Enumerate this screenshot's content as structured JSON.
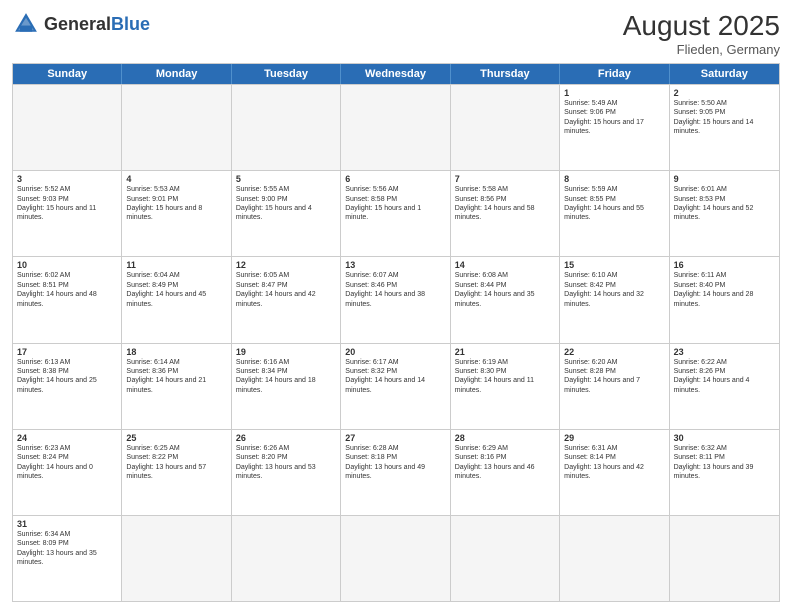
{
  "header": {
    "logo_general": "General",
    "logo_blue": "Blue",
    "month_year": "August 2025",
    "location": "Flieden, Germany"
  },
  "days_of_week": [
    "Sunday",
    "Monday",
    "Tuesday",
    "Wednesday",
    "Thursday",
    "Friday",
    "Saturday"
  ],
  "rows": [
    [
      {
        "day": "",
        "info": ""
      },
      {
        "day": "",
        "info": ""
      },
      {
        "day": "",
        "info": ""
      },
      {
        "day": "",
        "info": ""
      },
      {
        "day": "",
        "info": ""
      },
      {
        "day": "1",
        "info": "Sunrise: 5:49 AM\nSunset: 9:06 PM\nDaylight: 15 hours and 17 minutes."
      },
      {
        "day": "2",
        "info": "Sunrise: 5:50 AM\nSunset: 9:05 PM\nDaylight: 15 hours and 14 minutes."
      }
    ],
    [
      {
        "day": "3",
        "info": "Sunrise: 5:52 AM\nSunset: 9:03 PM\nDaylight: 15 hours and 11 minutes."
      },
      {
        "day": "4",
        "info": "Sunrise: 5:53 AM\nSunset: 9:01 PM\nDaylight: 15 hours and 8 minutes."
      },
      {
        "day": "5",
        "info": "Sunrise: 5:55 AM\nSunset: 9:00 PM\nDaylight: 15 hours and 4 minutes."
      },
      {
        "day": "6",
        "info": "Sunrise: 5:56 AM\nSunset: 8:58 PM\nDaylight: 15 hours and 1 minute."
      },
      {
        "day": "7",
        "info": "Sunrise: 5:58 AM\nSunset: 8:56 PM\nDaylight: 14 hours and 58 minutes."
      },
      {
        "day": "8",
        "info": "Sunrise: 5:59 AM\nSunset: 8:55 PM\nDaylight: 14 hours and 55 minutes."
      },
      {
        "day": "9",
        "info": "Sunrise: 6:01 AM\nSunset: 8:53 PM\nDaylight: 14 hours and 52 minutes."
      }
    ],
    [
      {
        "day": "10",
        "info": "Sunrise: 6:02 AM\nSunset: 8:51 PM\nDaylight: 14 hours and 48 minutes."
      },
      {
        "day": "11",
        "info": "Sunrise: 6:04 AM\nSunset: 8:49 PM\nDaylight: 14 hours and 45 minutes."
      },
      {
        "day": "12",
        "info": "Sunrise: 6:05 AM\nSunset: 8:47 PM\nDaylight: 14 hours and 42 minutes."
      },
      {
        "day": "13",
        "info": "Sunrise: 6:07 AM\nSunset: 8:46 PM\nDaylight: 14 hours and 38 minutes."
      },
      {
        "day": "14",
        "info": "Sunrise: 6:08 AM\nSunset: 8:44 PM\nDaylight: 14 hours and 35 minutes."
      },
      {
        "day": "15",
        "info": "Sunrise: 6:10 AM\nSunset: 8:42 PM\nDaylight: 14 hours and 32 minutes."
      },
      {
        "day": "16",
        "info": "Sunrise: 6:11 AM\nSunset: 8:40 PM\nDaylight: 14 hours and 28 minutes."
      }
    ],
    [
      {
        "day": "17",
        "info": "Sunrise: 6:13 AM\nSunset: 8:38 PM\nDaylight: 14 hours and 25 minutes."
      },
      {
        "day": "18",
        "info": "Sunrise: 6:14 AM\nSunset: 8:36 PM\nDaylight: 14 hours and 21 minutes."
      },
      {
        "day": "19",
        "info": "Sunrise: 6:16 AM\nSunset: 8:34 PM\nDaylight: 14 hours and 18 minutes."
      },
      {
        "day": "20",
        "info": "Sunrise: 6:17 AM\nSunset: 8:32 PM\nDaylight: 14 hours and 14 minutes."
      },
      {
        "day": "21",
        "info": "Sunrise: 6:19 AM\nSunset: 8:30 PM\nDaylight: 14 hours and 11 minutes."
      },
      {
        "day": "22",
        "info": "Sunrise: 6:20 AM\nSunset: 8:28 PM\nDaylight: 14 hours and 7 minutes."
      },
      {
        "day": "23",
        "info": "Sunrise: 6:22 AM\nSunset: 8:26 PM\nDaylight: 14 hours and 4 minutes."
      }
    ],
    [
      {
        "day": "24",
        "info": "Sunrise: 6:23 AM\nSunset: 8:24 PM\nDaylight: 14 hours and 0 minutes."
      },
      {
        "day": "25",
        "info": "Sunrise: 6:25 AM\nSunset: 8:22 PM\nDaylight: 13 hours and 57 minutes."
      },
      {
        "day": "26",
        "info": "Sunrise: 6:26 AM\nSunset: 8:20 PM\nDaylight: 13 hours and 53 minutes."
      },
      {
        "day": "27",
        "info": "Sunrise: 6:28 AM\nSunset: 8:18 PM\nDaylight: 13 hours and 49 minutes."
      },
      {
        "day": "28",
        "info": "Sunrise: 6:29 AM\nSunset: 8:16 PM\nDaylight: 13 hours and 46 minutes."
      },
      {
        "day": "29",
        "info": "Sunrise: 6:31 AM\nSunset: 8:14 PM\nDaylight: 13 hours and 42 minutes."
      },
      {
        "day": "30",
        "info": "Sunrise: 6:32 AM\nSunset: 8:11 PM\nDaylight: 13 hours and 39 minutes."
      }
    ],
    [
      {
        "day": "31",
        "info": "Sunrise: 6:34 AM\nSunset: 8:09 PM\nDaylight: 13 hours and 35 minutes."
      },
      {
        "day": "",
        "info": ""
      },
      {
        "day": "",
        "info": ""
      },
      {
        "day": "",
        "info": ""
      },
      {
        "day": "",
        "info": ""
      },
      {
        "day": "",
        "info": ""
      },
      {
        "day": "",
        "info": ""
      }
    ]
  ]
}
